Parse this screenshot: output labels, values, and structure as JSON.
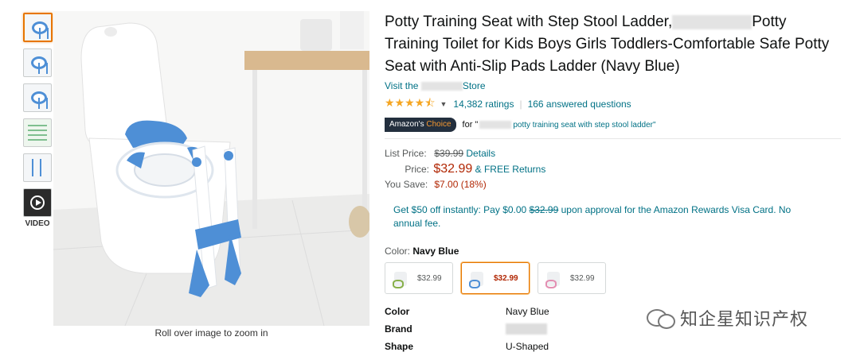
{
  "product": {
    "title_part1": "Potty Training Seat with Step Stool Ladder,",
    "title_part2": "Potty Training Toilet for Kids Boys Girls Toddlers-Comfortable Safe Potty Seat with Anti-Slip Pads Ladder (Navy Blue)",
    "store_prefix": "Visit the",
    "store_suffix": "Store"
  },
  "gallery": {
    "video_label": "VIDEO",
    "zoom_hint": "Roll over image to zoom in"
  },
  "ratings": {
    "stars": "★★★★⯪",
    "count": "14,382 ratings",
    "answered": "166 answered questions"
  },
  "choice": {
    "badge_prefix": "Amazon's",
    "badge_highlight": "Choice",
    "for_text": "for \"",
    "query": "potty training seat with step stool ladder\""
  },
  "pricing": {
    "list_label": "List Price:",
    "list_price": "$39.99",
    "details_link": "Details",
    "price_label": "Price:",
    "price": "$32.99",
    "free_returns": "& FREE Returns",
    "save_label": "You Save:",
    "save_value": "$7.00 (18%)"
  },
  "promo": {
    "text_before": "Get $50 off instantly: Pay $0.00",
    "struck": "$32.99",
    "text_after": "upon approval for the Amazon Rewards Visa Card. No annual fee."
  },
  "color": {
    "label": "Color:",
    "selected": "Navy Blue",
    "swatch_prices": [
      "$32.99",
      "$32.99",
      "$32.99"
    ]
  },
  "specs": [
    {
      "key": "Color",
      "value": "Navy Blue"
    },
    {
      "key": "Brand",
      "value": ""
    },
    {
      "key": "Shape",
      "value": "U-Shaped"
    }
  ],
  "watermark": "知企星知识产权",
  "colors": {
    "link": "#007185",
    "price": "#b12704",
    "badge_bg": "#232f3e",
    "badge_accent": "#f69931",
    "selected_border": "#e77600",
    "seat_blue": "#4e8fd6"
  }
}
